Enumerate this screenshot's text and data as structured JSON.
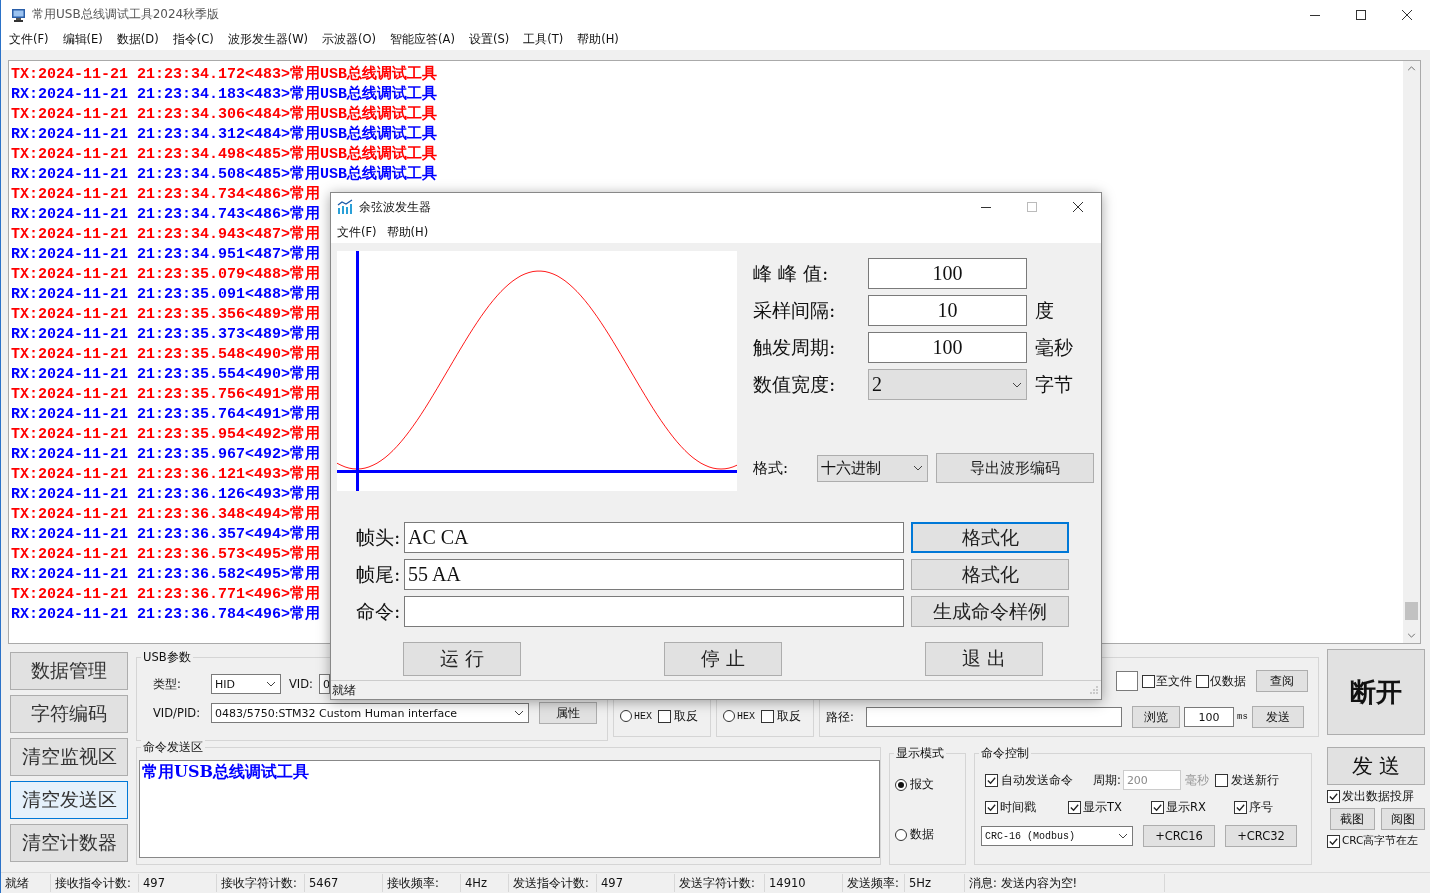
{
  "window": {
    "title": "常用USB总线调试工具2024秋季版"
  },
  "menu": [
    "文件(F)",
    "编辑(E)",
    "数据(D)",
    "指令(C)",
    "波形发生器(W)",
    "示波器(O)",
    "智能应答(A)",
    "设置(S)",
    "工具(T)",
    "帮助(H)"
  ],
  "log": [
    {
      "color": "#ff0000",
      "text": "TX:2024-11-21 21:23:34.172<483>常用USB总线调试工具"
    },
    {
      "color": "#0000ff",
      "text": "RX:2024-11-21 21:23:34.183<483>常用USB总线调试工具"
    },
    {
      "color": "#ff0000",
      "text": "TX:2024-11-21 21:23:34.306<484>常用USB总线调试工具"
    },
    {
      "color": "#0000ff",
      "text": "RX:2024-11-21 21:23:34.312<484>常用USB总线调试工具"
    },
    {
      "color": "#ff0000",
      "text": "TX:2024-11-21 21:23:34.498<485>常用USB总线调试工具"
    },
    {
      "color": "#0000ff",
      "text": "RX:2024-11-21 21:23:34.508<485>常用USB总线调试工具"
    },
    {
      "color": "#ff0000",
      "text": "TX:2024-11-21 21:23:34.734<486>常用"
    },
    {
      "color": "#0000ff",
      "text": "RX:2024-11-21 21:23:34.743<486>常用"
    },
    {
      "color": "#ff0000",
      "text": "TX:2024-11-21 21:23:34.943<487>常用"
    },
    {
      "color": "#0000ff",
      "text": "RX:2024-11-21 21:23:34.951<487>常用"
    },
    {
      "color": "#ff0000",
      "text": "TX:2024-11-21 21:23:35.079<488>常用"
    },
    {
      "color": "#0000ff",
      "text": "RX:2024-11-21 21:23:35.091<488>常用"
    },
    {
      "color": "#ff0000",
      "text": "TX:2024-11-21 21:23:35.356<489>常用"
    },
    {
      "color": "#0000ff",
      "text": "RX:2024-11-21 21:23:35.373<489>常用"
    },
    {
      "color": "#ff0000",
      "text": "TX:2024-11-21 21:23:35.548<490>常用"
    },
    {
      "color": "#0000ff",
      "text": "RX:2024-11-21 21:23:35.554<490>常用"
    },
    {
      "color": "#ff0000",
      "text": "TX:2024-11-21 21:23:35.756<491>常用"
    },
    {
      "color": "#0000ff",
      "text": "RX:2024-11-21 21:23:35.764<491>常用"
    },
    {
      "color": "#ff0000",
      "text": "TX:2024-11-21 21:23:35.954<492>常用"
    },
    {
      "color": "#0000ff",
      "text": "RX:2024-11-21 21:23:35.967<492>常用"
    },
    {
      "color": "#ff0000",
      "text": "TX:2024-11-21 21:23:36.121<493>常用"
    },
    {
      "color": "#0000ff",
      "text": "RX:2024-11-21 21:23:36.126<493>常用"
    },
    {
      "color": "#ff0000",
      "text": "TX:2024-11-21 21:23:36.348<494>常用"
    },
    {
      "color": "#0000ff",
      "text": "RX:2024-11-21 21:23:36.357<494>常用"
    },
    {
      "color": "#ff0000",
      "text": "TX:2024-11-21 21:23:36.573<495>常用"
    },
    {
      "color": "#0000ff",
      "text": "RX:2024-11-21 21:23:36.582<495>常用"
    },
    {
      "color": "#ff0000",
      "text": "TX:2024-11-21 21:23:36.771<496>常用"
    },
    {
      "color": "#0000ff",
      "text": "RX:2024-11-21 21:23:36.784<496>常用"
    }
  ],
  "side_buttons": [
    {
      "label": "数据管理",
      "selected": false
    },
    {
      "label": "字符编码",
      "selected": false
    },
    {
      "label": "清空监视区",
      "selected": false
    },
    {
      "label": "清空发送区",
      "selected": true
    },
    {
      "label": "清空计数器",
      "selected": false
    }
  ],
  "usb_params": {
    "title": "USB参数",
    "type_label": "类型:",
    "type_value": "HID",
    "vid_label": "VID:",
    "vid_value": "0",
    "vidpid_label": "VID/PID:",
    "vidpid_value": "0483/5750:STM32 Custom Human interface",
    "props_button": "属性"
  },
  "hex_groups": [
    {
      "hex": {
        "label": "HEX",
        "selected": false
      },
      "invert": {
        "label": "取反",
        "checked": false
      }
    },
    {
      "hex": {
        "label": "HEX",
        "selected": false
      },
      "invert": {
        "label": "取反",
        "checked": false
      }
    }
  ],
  "file_panel": {
    "to_file": {
      "label": "至文件",
      "checked": false
    },
    "data_only": {
      "label": "仅数据",
      "checked": false
    },
    "view_button": "查阅",
    "path_label": "路径:",
    "browse_button": "浏览",
    "interval": "100",
    "interval_unit": "ms",
    "send_button": "发送"
  },
  "right_panel": {
    "disconnect_button": "断开",
    "send_button": "发 送",
    "project": {
      "label": "发出数据投屏",
      "checked": true
    },
    "screenshot_button": "截图",
    "view_button": "阅图",
    "crc_high": {
      "label": "CRC高字节在左",
      "checked": true
    }
  },
  "send_area": {
    "title": "命令发送区",
    "text": "常用USB总线调试工具"
  },
  "display_mode": {
    "title": "显示模式",
    "options": [
      {
        "label": "报文",
        "selected": true
      },
      {
        "label": "数据",
        "selected": false
      }
    ]
  },
  "command_control": {
    "title": "命令控制",
    "auto_send": {
      "label": "自动发送命令",
      "checked": true
    },
    "period_label": "周期:",
    "period_value": "200",
    "period_unit": "毫秒",
    "period_disabled": true,
    "new_line": {
      "label": "发送新行",
      "checked": false
    },
    "options": [
      {
        "label": "时间戳",
        "checked": true
      },
      {
        "label": "显示TX",
        "checked": true
      },
      {
        "label": "显示RX",
        "checked": true
      },
      {
        "label": "序号",
        "checked": true
      }
    ],
    "crc_mode": "CRC-16 (Modbus)",
    "crc_buttons": [
      "+CRC16",
      "+CRC32"
    ]
  },
  "status_bar": [
    {
      "label": "就绪"
    },
    {
      "label": "接收指令计数:",
      "value": "497"
    },
    {
      "label": "接收字符计数:",
      "value": "5467"
    },
    {
      "label": "接收频率:",
      "value": "4Hz"
    },
    {
      "label": "发送指令计数:",
      "value": "497"
    },
    {
      "label": "发送字符计数:",
      "value": "14910"
    },
    {
      "label": "发送频率:",
      "value": "5Hz"
    },
    {
      "label": "消息: 发送内容为空!"
    }
  ],
  "dialog": {
    "title": "余弦波发生器",
    "menu": [
      "文件(F)",
      "帮助(H)"
    ],
    "params": [
      {
        "label": "峰 峰 值:",
        "value": "100",
        "kind": "input"
      },
      {
        "label": "采样间隔:",
        "value": "10",
        "unit": "度",
        "kind": "input"
      },
      {
        "label": "触发周期:",
        "value": "100",
        "unit": "毫秒",
        "kind": "input"
      },
      {
        "label": "数值宽度:",
        "value": "2",
        "unit": "字节",
        "kind": "select"
      }
    ],
    "format_label": "格式:",
    "format_value": "十六进制",
    "export_button": "导出波形编码",
    "frames": [
      {
        "label": "帧头:",
        "value": "AC CA",
        "button": "格式化",
        "focused": true
      },
      {
        "label": "帧尾:",
        "value": "55 AA",
        "button": "格式化",
        "focused": false
      },
      {
        "label": "命令:",
        "button": "生成命令样例",
        "focused": false
      }
    ],
    "actions": [
      "运 行",
      "停 止",
      "退 出"
    ],
    "status": "就绪"
  }
}
